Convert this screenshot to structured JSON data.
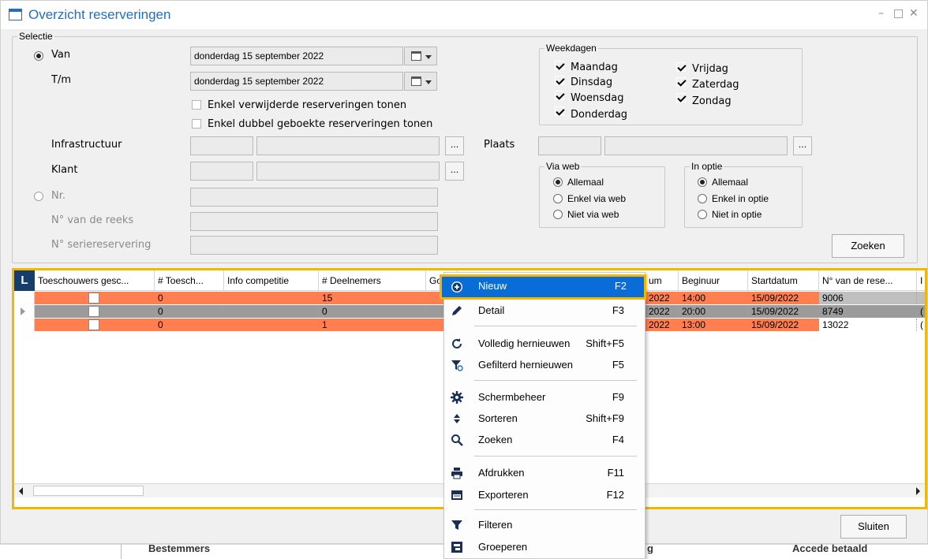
{
  "window": {
    "title": "Overzicht reserveringen",
    "minimize": "–",
    "maximize": "□",
    "close": "✕"
  },
  "selectie": {
    "legend": "Selectie",
    "van_label": "Van",
    "tm_label": "T/m",
    "van_value": "donderdag 15 september 2022",
    "tm_value": "donderdag 15 september 2022",
    "chk_verwijderd": "Enkel verwijderde reserveringen tonen",
    "chk_dubbel": "Enkel dubbel geboekte reserveringen tonen",
    "infra_label": "Infrastructuur",
    "klant_label": "Klant",
    "plaats_label": "Plaats",
    "nr_label": "Nr.",
    "reeks_label": "N° van de reeks",
    "serie_label": "N° seriereservering",
    "dots": "...",
    "zoeken": "Zoeken"
  },
  "weekdagen": {
    "legend": "Weekdagen",
    "days": [
      "Maandag",
      "Dinsdag",
      "Woensdag",
      "Donderdag",
      "Vrijdag",
      "Zaterdag",
      "Zondag"
    ]
  },
  "via_web": {
    "legend": "Via web",
    "options": [
      "Allemaal",
      "Enkel via web",
      "Niet via web"
    ]
  },
  "in_optie": {
    "legend": "In optie",
    "options": [
      "Allemaal",
      "Enkel in optie",
      "Niet in optie"
    ]
  },
  "grid": {
    "badge": "L",
    "headers": [
      "Toeschouwers gesc...",
      "# Toesch...",
      "Info competitie",
      "# Deelnemers",
      "Go",
      "um",
      "Beginuur",
      "Startdatum",
      "N° van de rese...",
      "I"
    ],
    "rows": [
      {
        "toesch": "0",
        "deelnemers": "15",
        "datum": "2022",
        "beginuur": "14:00",
        "startdatum": "15/09/2022",
        "nr": "9006",
        "extra": ""
      },
      {
        "toesch": "0",
        "deelnemers": "0",
        "datum": "2022",
        "beginuur": "20:00",
        "startdatum": "15/09/2022",
        "nr": "8749",
        "extra": "("
      },
      {
        "toesch": "0",
        "deelnemers": "1",
        "datum": "2022",
        "beginuur": "13:00",
        "startdatum": "15/09/2022",
        "nr": "13022",
        "extra": "("
      }
    ],
    "colors": {
      "orange": "#ff7f50",
      "grey": "#9b9b9b",
      "grey_light": "#bfbfbf"
    }
  },
  "context_menu": {
    "items": [
      {
        "label": "Nieuw",
        "key": "F2",
        "icon": "plus-circle-icon"
      },
      {
        "label": "Detail",
        "key": "F3",
        "icon": "pencil-icon"
      },
      {
        "label": "Volledig hernieuwen",
        "key": "Shift+F5",
        "icon": "refresh-icon"
      },
      {
        "label": "Gefilterd hernieuwen",
        "key": "F5",
        "icon": "filter-refresh-icon"
      },
      {
        "label": "Schermbeheer",
        "key": "F9",
        "icon": "gear-icon"
      },
      {
        "label": "Sorteren",
        "key": "Shift+F9",
        "icon": "sort-icon"
      },
      {
        "label": "Zoeken",
        "key": "F4",
        "icon": "search-icon"
      },
      {
        "label": "Afdrukken",
        "key": "F11",
        "icon": "printer-icon"
      },
      {
        "label": "Exporteren",
        "key": "F12",
        "icon": "export-icon"
      },
      {
        "label": "Filteren",
        "key": "",
        "icon": "filter-icon"
      },
      {
        "label": "Groeperen",
        "key": "",
        "icon": "group-icon"
      }
    ]
  },
  "footer": {
    "sluiten": "Sluiten",
    "under_left": "Bestemmers",
    "under_mid": "g",
    "under_right": "Accede betaald"
  },
  "accent": "#f0b800",
  "menu_highlight": "#0a6cd6",
  "title_color": "#1f6fc6"
}
